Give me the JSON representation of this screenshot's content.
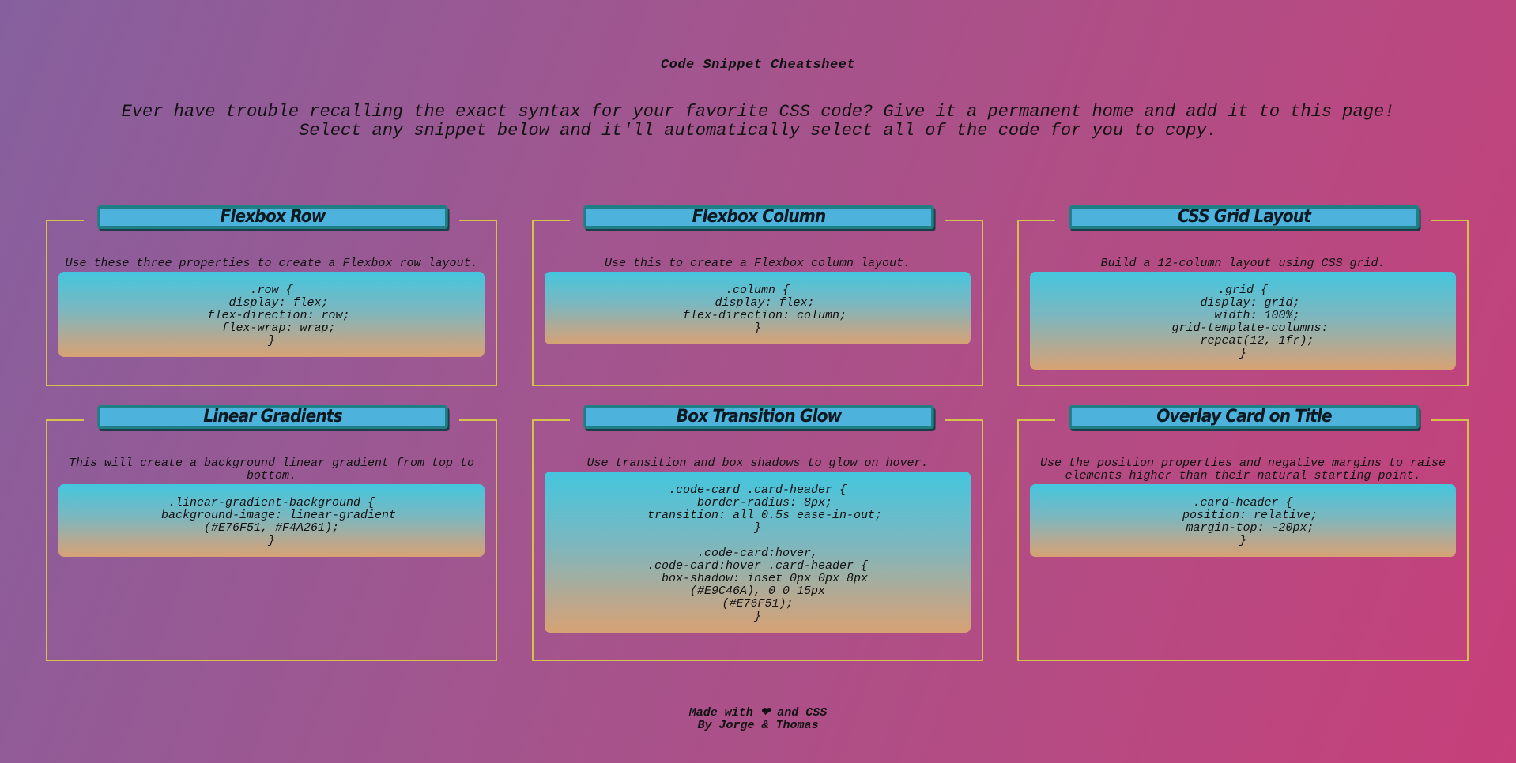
{
  "page": {
    "title": "Code Snippet Cheatsheet",
    "intro_line1": "Ever have trouble recalling the exact syntax for your favorite CSS code? Give it a permanent home and add it to this page!",
    "intro_line2": "Select any snippet below and it'll automatically select all of the code for you to copy."
  },
  "cards": [
    {
      "title": "Flexbox Row",
      "description": "Use these three properties to create a Flexbox row layout.",
      "code": ".row {\n  display: flex;\n  flex-direction: row;\n  flex-wrap: wrap;\n}"
    },
    {
      "title": "Flexbox Column",
      "description": "Use this to create a Flexbox column layout.",
      "code": ".column {\n  display: flex;\n  flex-direction: column;\n}"
    },
    {
      "title": "CSS Grid Layout",
      "description": "Build a 12-column layout using CSS grid.",
      "code": ".grid {\n  display: grid;\n    width: 100%;\n  grid-template-columns:\n    repeat(12, 1fr);\n}"
    },
    {
      "title": "Linear Gradients",
      "description": "This will create a background linear gradient from top to bottom.",
      "code": ".linear-gradient-background {\n  background-image: linear-gradient\n(#E76F51, #F4A261);\n}"
    },
    {
      "title": "Box Transition Glow",
      "description": "Use transition and box shadows to glow on hover.",
      "code": ".code-card .card-header {\n  border-radius: 8px;\n  transition: all 0.5s ease-in-out;\n}\n\n.code-card:hover,\n.code-card:hover .card-header {\n  box-shadow: inset 0px 0px 8px\n(#E9C46A), 0 0 15px\n(#E76F51);\n}"
    },
    {
      "title": "Overlay Card on Title",
      "description": "Use the position properties and negative margins to raise elements higher than their natural starting point.",
      "code": ".card-header {\n  position: relative;\n  margin-top: -20px;\n}"
    }
  ],
  "footer": {
    "line1": "Made with ❤ and CSS",
    "line2": "By Jorge & Thomas"
  },
  "colors": {
    "card_border": "#d5c04a",
    "header_bg": "#4db3dd",
    "header_border": "#1f7f84",
    "snippet_top": "#44c6de",
    "snippet_bottom": "#d7a274"
  }
}
